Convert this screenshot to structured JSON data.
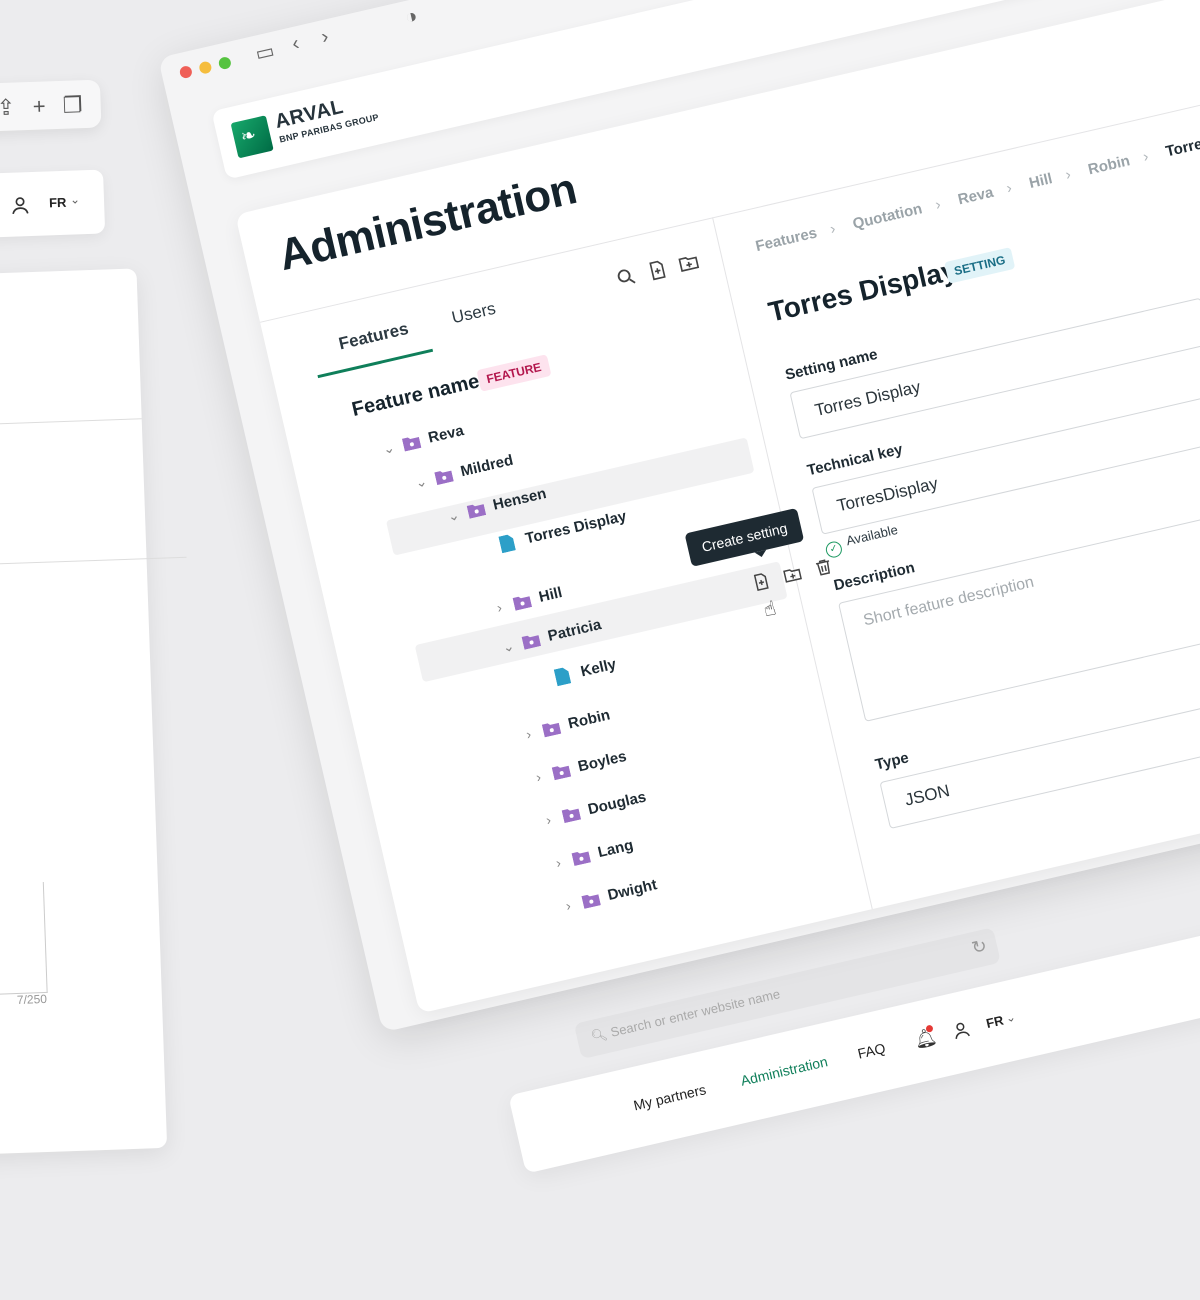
{
  "left_window": {
    "language": "FR",
    "char_count": "7/250"
  },
  "browser": {
    "address_placeholder": "Search or enter website name"
  },
  "brand": {
    "name": "ARVAL",
    "subtitle": "BNP PARIBAS GROUP"
  },
  "page": {
    "title": "Administration"
  },
  "tabs": [
    {
      "label": "Features",
      "active": true
    },
    {
      "label": "Users",
      "active": false
    }
  ],
  "tree": {
    "heading": "Feature name",
    "heading_badge": "FEATURE",
    "nodes": [
      {
        "label": "Reva",
        "type": "folder",
        "expanded": true
      },
      {
        "label": "Mildred",
        "type": "folder",
        "expanded": true
      },
      {
        "label": "Hensen",
        "type": "folder",
        "expanded": true
      },
      {
        "label": "Torres Display",
        "type": "setting",
        "selected": true
      },
      {
        "label": "Hill",
        "type": "folder",
        "expanded": false
      },
      {
        "label": "Patricia",
        "type": "folder",
        "expanded": true
      },
      {
        "label": "Kelly",
        "type": "setting"
      },
      {
        "label": "Robin",
        "type": "folder",
        "expanded": false
      },
      {
        "label": "Boyles",
        "type": "folder",
        "expanded": false
      },
      {
        "label": "Douglas",
        "type": "folder",
        "expanded": false
      },
      {
        "label": "Lang",
        "type": "folder",
        "expanded": false
      },
      {
        "label": "Dwight",
        "type": "folder",
        "expanded": false
      }
    ],
    "tooltip": "Create setting"
  },
  "detail": {
    "breadcrumbs": [
      "Features",
      "Quotation",
      "Reva",
      "Hill",
      "Robin",
      "Torres Display"
    ],
    "title": "Torres Display",
    "badge": "SETTING",
    "setting_name_label": "Setting name",
    "setting_name_value": "Torres Display",
    "technical_key_label": "Technical key",
    "technical_key_value": "TorresDisplay",
    "availability": "Available",
    "description_label": "Description",
    "description_placeholder": "Short feature description",
    "type_label": "Type",
    "type_value": "JSON"
  },
  "bottom_nav": {
    "links": [
      "My partners",
      "Administration",
      "FAQ"
    ],
    "active": "Administration",
    "language": "FR"
  },
  "colors": {
    "accent": "#0f7f5a",
    "folder": "#9b6fc6",
    "setting_file": "#2c9fc8",
    "feature_badge_bg": "#fde3ee",
    "setting_badge_bg": "#e1f3f8",
    "notification_dot": "#e53935"
  }
}
